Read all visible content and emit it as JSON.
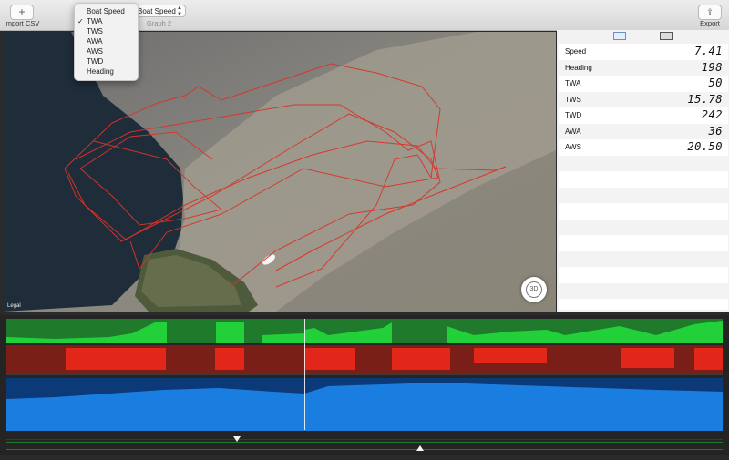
{
  "toolbar": {
    "import_icon": "plus-icon",
    "import_label": "Import CSV",
    "graph2_value": "Boat Speed",
    "graph2_label": "Graph 2",
    "export_icon": "share-icon",
    "export_label": "Export"
  },
  "dropdown": {
    "selected": "TWA",
    "options": [
      "Boat Speed",
      "TWA",
      "TWS",
      "AWA",
      "AWS",
      "TWD",
      "Heading"
    ]
  },
  "map": {
    "legal_label": "Legal",
    "btn3d_label": "3D",
    "track_color": "#d9342b"
  },
  "side": {
    "tabs": [
      "graph-tab-icon",
      "table-tab-icon"
    ],
    "rows": [
      {
        "label": "Speed",
        "value": "7.41"
      },
      {
        "label": "Heading",
        "value": "198"
      },
      {
        "label": "TWA",
        "value": "50"
      },
      {
        "label": "TWS",
        "value": "15.78"
      },
      {
        "label": "TWD",
        "value": "242"
      },
      {
        "label": "AWA",
        "value": "36"
      },
      {
        "label": "AWS",
        "value": "20.50"
      }
    ]
  },
  "graphs": {
    "colors": {
      "green": "#1f7a2c",
      "green_bright": "#22d13a",
      "red": "#7a1f18",
      "red_bright": "#e3261a",
      "blue": "#0c3a78",
      "blue_bright": "#1a7ee0"
    }
  }
}
